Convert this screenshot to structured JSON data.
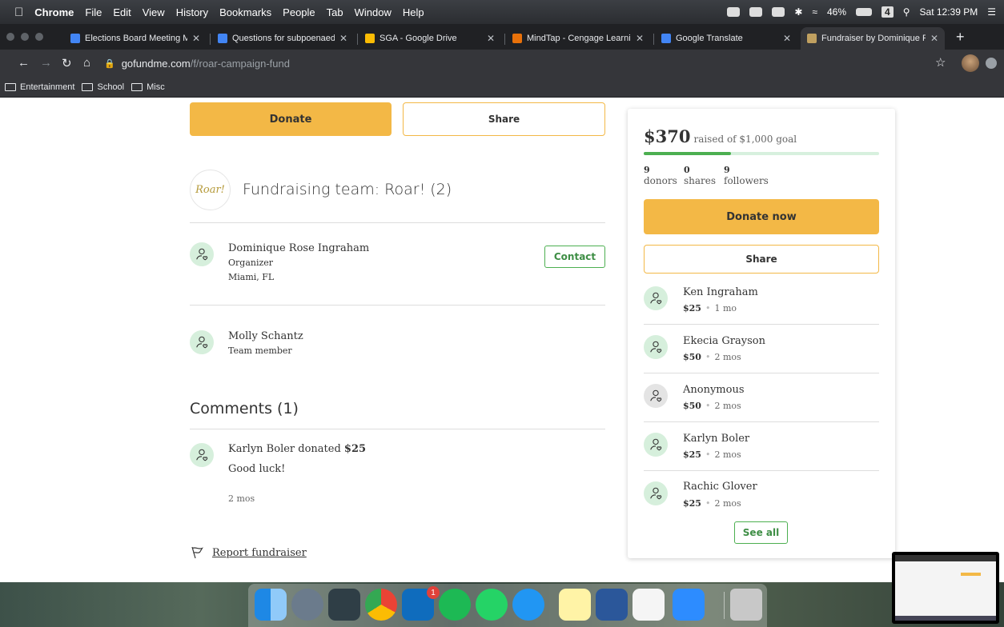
{
  "menubar": {
    "apple": "",
    "app": "Chrome",
    "items": [
      "File",
      "Edit",
      "View",
      "History",
      "Bookmarks",
      "People",
      "Tab",
      "Window",
      "Help"
    ],
    "battery": "46%",
    "badge": "4",
    "clock": "Sat 12:39 PM"
  },
  "tabs": [
    {
      "title": "Elections Board Meeting Mi",
      "color": "#4285f4"
    },
    {
      "title": "Questions for subpoenaed",
      "color": "#4285f4"
    },
    {
      "title": "SGA - Google Drive",
      "color": "#fbbc04"
    },
    {
      "title": "MindTap - Cengage Learnin",
      "color": "#e8710a"
    },
    {
      "title": "Google Translate",
      "color": "#4285f4"
    },
    {
      "title": "Fundraiser by Dominique Ro",
      "color": "#c0a060"
    }
  ],
  "address": {
    "host": "gofundme.com",
    "path": "/f/roar-campaign-fund"
  },
  "bookmarks": [
    "Entertainment",
    "School",
    "Misc"
  ],
  "main": {
    "donate_label": "Donate",
    "share_label": "Share",
    "team_logo_text": "Roar!",
    "team_title": "Fundraising team: Roar! (2)",
    "organizer": {
      "name": "Dominique Rose Ingraham",
      "role": "Organizer",
      "location": "Miami, FL",
      "contact_label": "Contact"
    },
    "member": {
      "name": "Molly Schantz",
      "role": "Team member"
    },
    "comments_title": "Comments (1)",
    "comment": {
      "author": "Karlyn Boler donated ",
      "amount": "$25",
      "text": "Good luck!",
      "time": "2 mos"
    },
    "report_label": "Report fundraiser"
  },
  "sidebar": {
    "raised": "$370",
    "goal_text": "raised of $1,000 goal",
    "progress": 0.37,
    "stats": [
      {
        "n": "9",
        "label": "donors"
      },
      {
        "n": "0",
        "label": "shares"
      },
      {
        "n": "9",
        "label": "followers"
      }
    ],
    "donate_now_label": "Donate now",
    "share_label": "Share",
    "donors": [
      {
        "name": "Ken Ingraham",
        "amount": "$25",
        "time": "1 mo"
      },
      {
        "name": "Ekecia Grayson",
        "amount": "$50",
        "time": "2 mos"
      },
      {
        "name": "Anonymous",
        "amount": "$50",
        "time": "2 mos"
      },
      {
        "name": "Karlyn Boler",
        "amount": "$25",
        "time": "2 mos"
      },
      {
        "name": "Rachic Glover",
        "amount": "$25",
        "time": "2 mos"
      }
    ],
    "see_all_label": "See all"
  },
  "dock": {
    "outlook_badge": "1"
  },
  "colors": {
    "accent": "#f3b846",
    "green": "#4caf50"
  }
}
